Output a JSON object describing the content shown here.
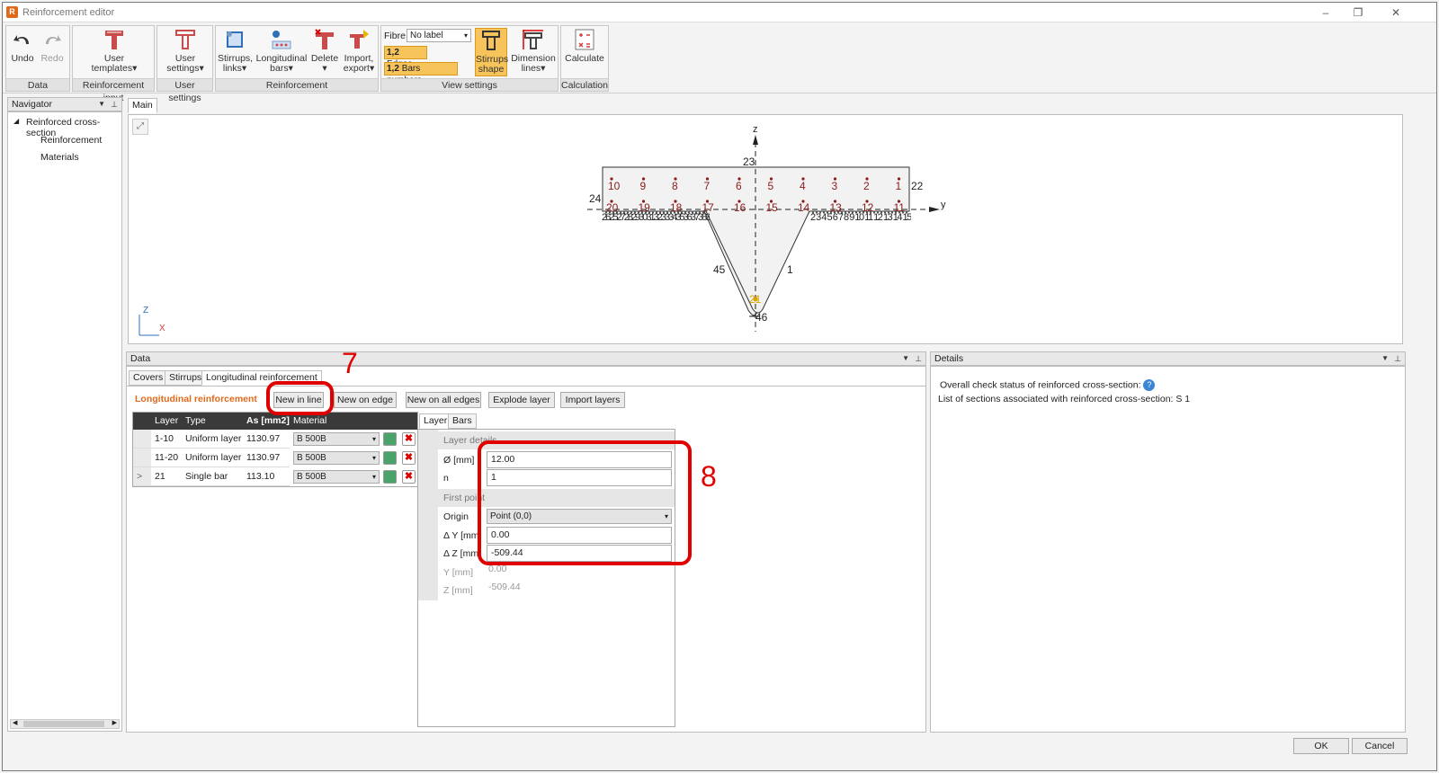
{
  "window": {
    "title": "Reinforcement editor",
    "app_icon": "reinforcement-editor-icon"
  },
  "ribbon": {
    "groups": {
      "data": "Data",
      "reinforcement_input": "Reinforcement input",
      "user_settings": "User settings",
      "reinforcement": "Reinforcement",
      "view_settings": "View settings",
      "calculation": "Calculation"
    },
    "undo": "Undo",
    "redo": "Redo",
    "user_templates": [
      "User",
      "templates▾"
    ],
    "user_settings_btn": [
      "User",
      "settings▾"
    ],
    "stirrups_links": [
      "Stirrups,",
      "links▾"
    ],
    "longitudinal_bars": [
      "Longitudinal",
      "bars▾"
    ],
    "delete": [
      "Delete",
      "▾"
    ],
    "import_export": [
      "Import,",
      "export▾"
    ],
    "fibre_label": "Fibre",
    "fibre_value": "No label",
    "edges_toggle": "Edges",
    "bars_numbers_toggle": "Bars numbers",
    "toggle_prefix": "1,2",
    "stirrups_shape": [
      "Stirrups",
      "shape"
    ],
    "dimension_lines": [
      "Dimension",
      "lines▾"
    ],
    "calculate": "Calculate"
  },
  "navigator": {
    "title": "Navigator",
    "root": "Reinforced cross-section",
    "items": [
      "Reinforcement",
      "Materials"
    ]
  },
  "main": {
    "tab": "Main",
    "axes": {
      "z": "z",
      "y": "y",
      "corner_z": "Z",
      "corner_x": "X"
    },
    "top_bar_numbers": [
      "10",
      "9",
      "8",
      "7",
      "6",
      "5",
      "4",
      "3",
      "2",
      "1"
    ],
    "bottom_bar_numbers": [
      "20",
      "19",
      "18",
      "17",
      "16",
      "15",
      "14",
      "13",
      "12",
      "11"
    ],
    "edge_labels": {
      "top": "23",
      "left": "24",
      "right": "22",
      "web_left": "45",
      "web_right": "1",
      "bottom": "46",
      "single_bar": "21"
    },
    "flange_left_numbers": "2625272829303132333435363738394041424344434",
    "flange_right_numbers": "2 3 4 5 6 7 8 9 10 11 12 13 14 15 16 17 18 19 20"
  },
  "data_panel": {
    "title": "Data",
    "tabs": [
      "Covers",
      "Stirrups",
      "Longitudinal reinforcement"
    ],
    "section_title": "Longitudinal reinforcement",
    "buttons": [
      "New in line",
      "New on edge",
      "New on all edges",
      "Explode layer",
      "Import layers"
    ],
    "table": {
      "headers": [
        "Layer",
        "Type",
        "As [mm2]",
        "Material"
      ],
      "rows": [
        {
          "marker": "",
          "layer": "1-10",
          "type": "Uniform layer",
          "as": "1130.97",
          "material": "B 500B"
        },
        {
          "marker": "",
          "layer": "11-20",
          "type": "Uniform layer",
          "as": "1130.97",
          "material": "B 500B"
        },
        {
          "marker": ">",
          "layer": "21",
          "type": "Single bar",
          "as": "113.10",
          "material": "B 500B"
        }
      ]
    },
    "prop_tabs": [
      "Layer",
      "Bars"
    ],
    "layer_details": {
      "title": "Layer details",
      "diameter_label": "Ø [mm]",
      "diameter_value": "12.00",
      "n_label": "n",
      "n_value": "1"
    },
    "first_point": {
      "title": "First point",
      "origin_label": "Origin",
      "origin_value": "Point (0,0)",
      "dy_label": "Δ Y [mm]",
      "dy_value": "0.00",
      "dz_label": "Δ Z [mm]",
      "dz_value": "-509.44",
      "y_label": "Y [mm]",
      "y_value": "0.00",
      "z_label": "Z [mm]",
      "z_value": "-509.44"
    }
  },
  "details_panel": {
    "title": "Details",
    "line1": "Overall check status of reinforced cross-section:",
    "line2": "List of sections associated with reinforced cross-section: S 1"
  },
  "annotations": {
    "step7": "7",
    "step8": "8"
  },
  "footer": {
    "ok": "OK",
    "cancel": "Cancel"
  },
  "colors": {
    "accent_orange": "#e06a1b",
    "annotation_red": "#e00000",
    "bar_red": "#8b1a1a",
    "active_toggle": "#f6c45a"
  }
}
